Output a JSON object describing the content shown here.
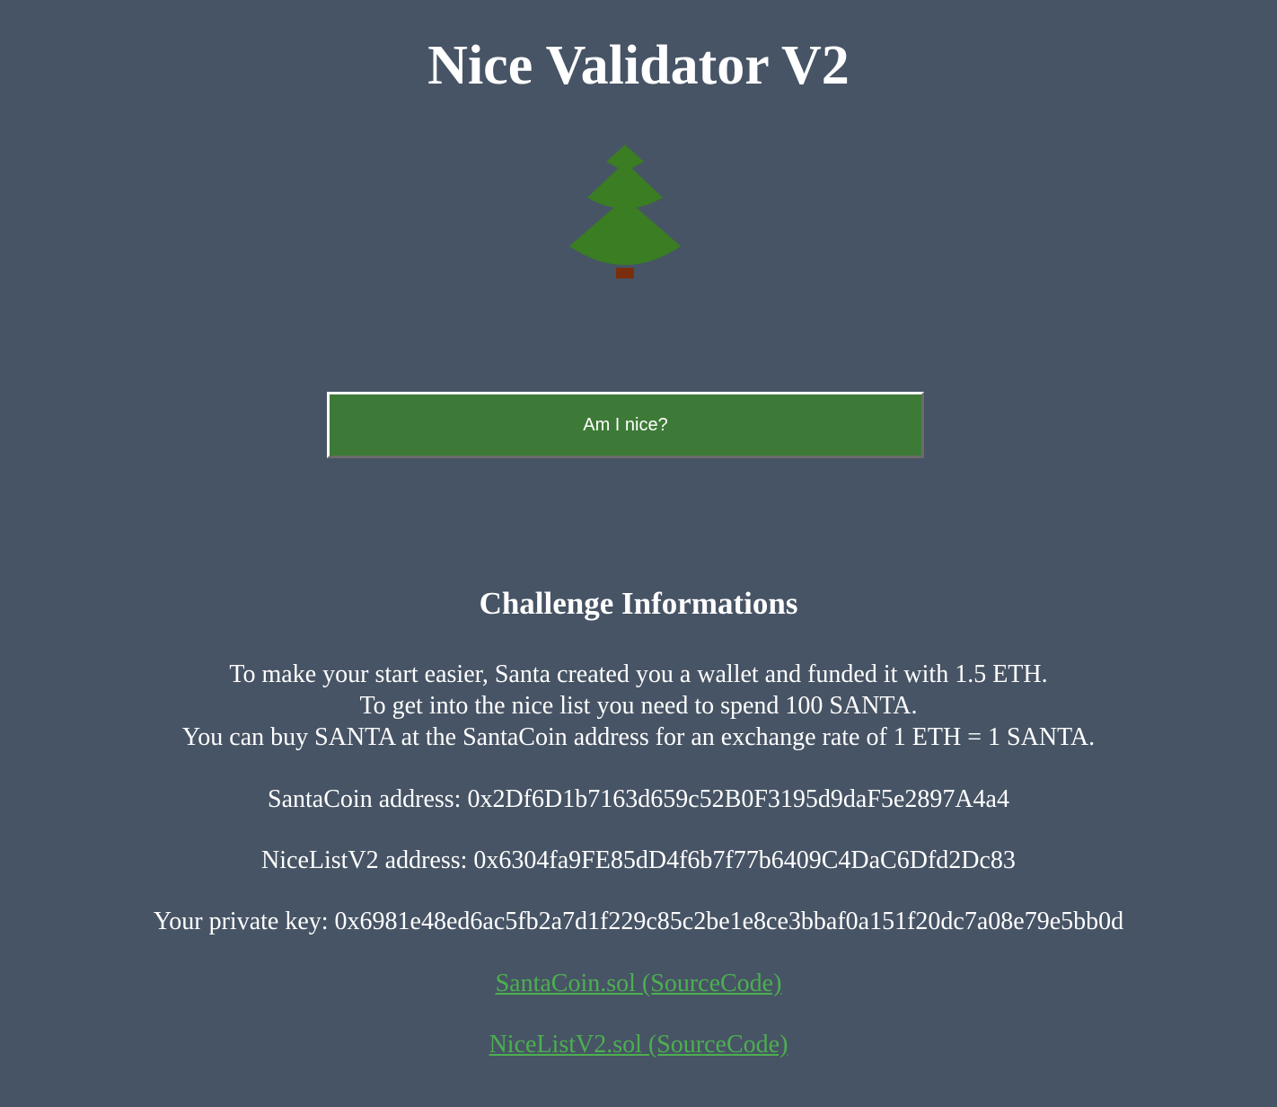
{
  "title": "Nice Validator V2",
  "tree": {
    "icon": "christmas-tree-icon",
    "foliage_color": "#3a7d22",
    "trunk_color": "#7a2e0e"
  },
  "button": {
    "label": "Am I nice?",
    "color": "#3d7a37"
  },
  "info": {
    "heading": "Challenge Informations",
    "intro_lines": [
      "To make your start easier, Santa created you a wallet and funded it with 1.5 ETH.",
      "To get into the nice list you need to spend 100 SANTA.",
      "You can buy SANTA at the SantaCoin address for an exchange rate of 1 ETH = 1 SANTA."
    ],
    "santacoin_address": "SantaCoin address: 0x2Df6D1b7163d659c52B0F3195d9daF5e2897A4a4",
    "nicelist_address": "NiceListV2 address: 0x6304fa9FE85dD4f6b7f77b6409C4DaC6Dfd2Dc83",
    "private_key": "Your private key: 0x6981e48ed6ac5fb2a7d1f229c85c2be1e8ce3bbaf0a151f20dc7a08e79e5bb0d"
  },
  "links": {
    "santacoin_source": "SantaCoin.sol (SourceCode)",
    "nicelist_source": "NiceListV2.sol (SourceCode)",
    "color": "#4caf50"
  },
  "colors": {
    "background": "#475465",
    "text": "#ffffff"
  }
}
